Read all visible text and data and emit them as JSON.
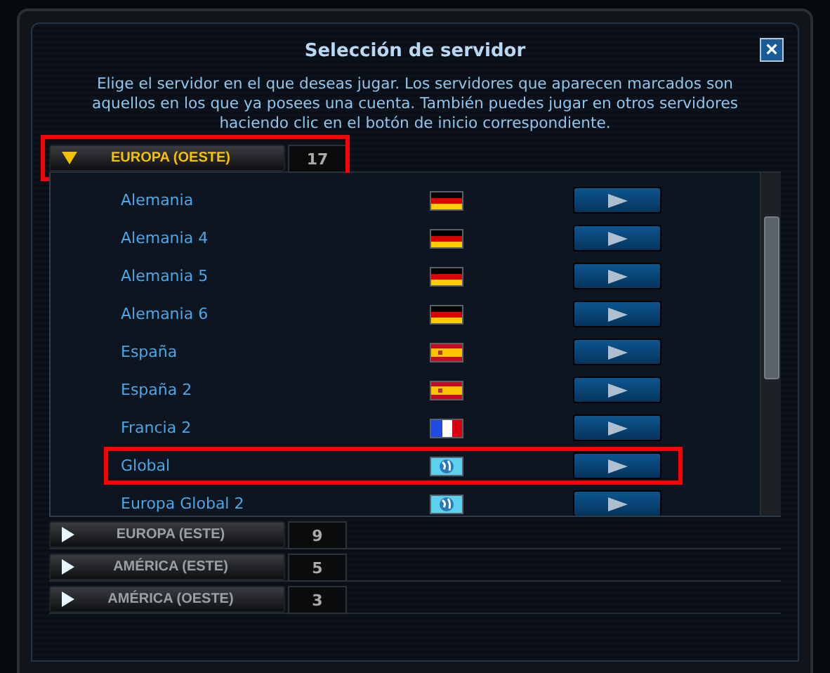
{
  "window": {
    "title": "Selección de servidor",
    "close": "×"
  },
  "description": "Elige el servidor en el que deseas jugar. Los servidores que aparecen marcados son aquellos en los que ya posees una cuenta. También puedes jugar en otros servidores haciendo clic en el botón de inicio correspondiente.",
  "regions": [
    {
      "name": "EUROPA (OESTE)",
      "count": "17",
      "expanded": true,
      "highlighted": true,
      "servers": [
        {
          "name": "Alemania",
          "kind": "de",
          "highlighted": false
        },
        {
          "name": "Alemania 4",
          "kind": "de",
          "highlighted": false
        },
        {
          "name": "Alemania 5",
          "kind": "de",
          "highlighted": false
        },
        {
          "name": "Alemania 6",
          "kind": "de",
          "highlighted": false
        },
        {
          "name": "España",
          "kind": "es",
          "highlighted": false
        },
        {
          "name": "España 2",
          "kind": "es",
          "highlighted": false
        },
        {
          "name": "Francia 2",
          "kind": "fr",
          "highlighted": false
        },
        {
          "name": "Global",
          "kind": "globe",
          "highlighted": true
        },
        {
          "name": "Europa Global 2",
          "kind": "globe",
          "highlighted": false
        }
      ]
    },
    {
      "name": "EUROPA (ESTE)",
      "count": "9",
      "expanded": false,
      "highlighted": false
    },
    {
      "name": "AMÉRICA (ESTE)",
      "count": "5",
      "expanded": false,
      "highlighted": false
    },
    {
      "name": "AMÉRICA (OESTE)",
      "count": "3",
      "expanded": false,
      "highlighted": false
    }
  ]
}
